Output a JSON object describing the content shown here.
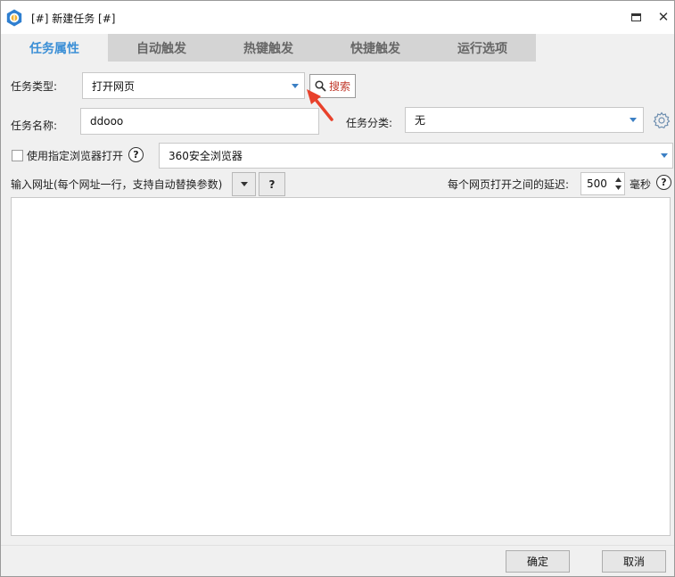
{
  "window": {
    "title": "[#] 新建任务 [#]",
    "close_glyph": "✕"
  },
  "tabs": [
    {
      "label": "任务属性",
      "active": true
    },
    {
      "label": "自动触发",
      "active": false
    },
    {
      "label": "热键触发",
      "active": false
    },
    {
      "label": "快捷触发",
      "active": false
    },
    {
      "label": "运行选项",
      "active": false
    }
  ],
  "form": {
    "task_type_label": "任务类型:",
    "task_type_value": "打开网页",
    "search_label": "搜索",
    "task_name_label": "任务名称:",
    "task_name_value": "ddooo",
    "category_label": "任务分类:",
    "category_value": "无",
    "use_browser_label": "使用指定浏览器打开",
    "use_browser_checked": false,
    "browser_value": "360安全浏览器",
    "url_label": "输入网址(每个网址一行，支持自动替换参数)",
    "url_help": "?",
    "help_glyph": "?",
    "delay_label": "每个网页打开之间的延迟:",
    "delay_value": "500",
    "delay_unit": "毫秒",
    "url_text": ""
  },
  "footer": {
    "ok_label": "确定",
    "cancel_label": "取消"
  },
  "colors": {
    "accent": "#3b8fd6",
    "annotation_arrow": "#e8412b",
    "search_text": "#c0392b"
  },
  "icons": {
    "app": "app-gear-icon",
    "maximize": "maximize-icon",
    "close": "close-icon",
    "search": "search-icon",
    "settings": "gear-icon",
    "dropdown": "caret-down-icon",
    "annotation": "red-arrow-icon"
  }
}
